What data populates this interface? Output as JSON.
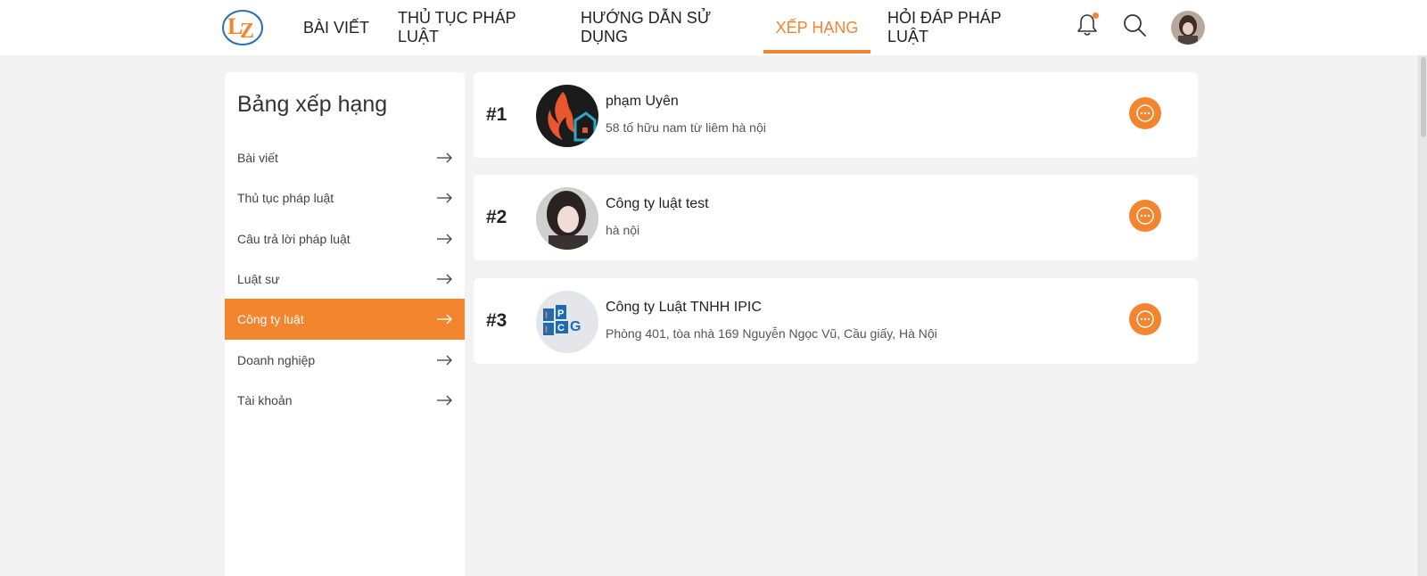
{
  "header": {
    "logo_alt": "LZ",
    "nav": [
      {
        "label": "BÀI VIẾT"
      },
      {
        "label": "THỦ TỤC PHÁP LUẬT"
      },
      {
        "label": "HƯỚNG DẪN SỬ DỤNG"
      },
      {
        "label": "XẾP HẠNG",
        "active": true
      },
      {
        "label": "HỎI ĐÁP PHÁP LUẬT"
      }
    ],
    "icons": [
      "bell-icon",
      "search-icon",
      "user-avatar"
    ],
    "accent_color": "#f4852f"
  },
  "sidebar": {
    "title": "Bảng xếp hạng",
    "items": [
      {
        "label": "Bài viết"
      },
      {
        "label": "Thủ tục pháp luật"
      },
      {
        "label": "Câu trả lời pháp luật"
      },
      {
        "label": "Luật sư"
      },
      {
        "label": "Công ty luật",
        "active": true
      },
      {
        "label": "Doanh nghiệp"
      },
      {
        "label": "Tài khoản"
      }
    ]
  },
  "rankings": [
    {
      "rank": "#1",
      "name": "phạm Uyên",
      "address": "58 tố hữu nam từ liêm hà nội"
    },
    {
      "rank": "#2",
      "name": "Công ty luật test",
      "address": "hà nội"
    },
    {
      "rank": "#3",
      "name": "Công ty Luật TNHH IPIC",
      "address": "Phòng 401, tòa nhà 169 Nguyễn Ngọc Vũ, Cầu giấy, Hà Nội"
    }
  ]
}
